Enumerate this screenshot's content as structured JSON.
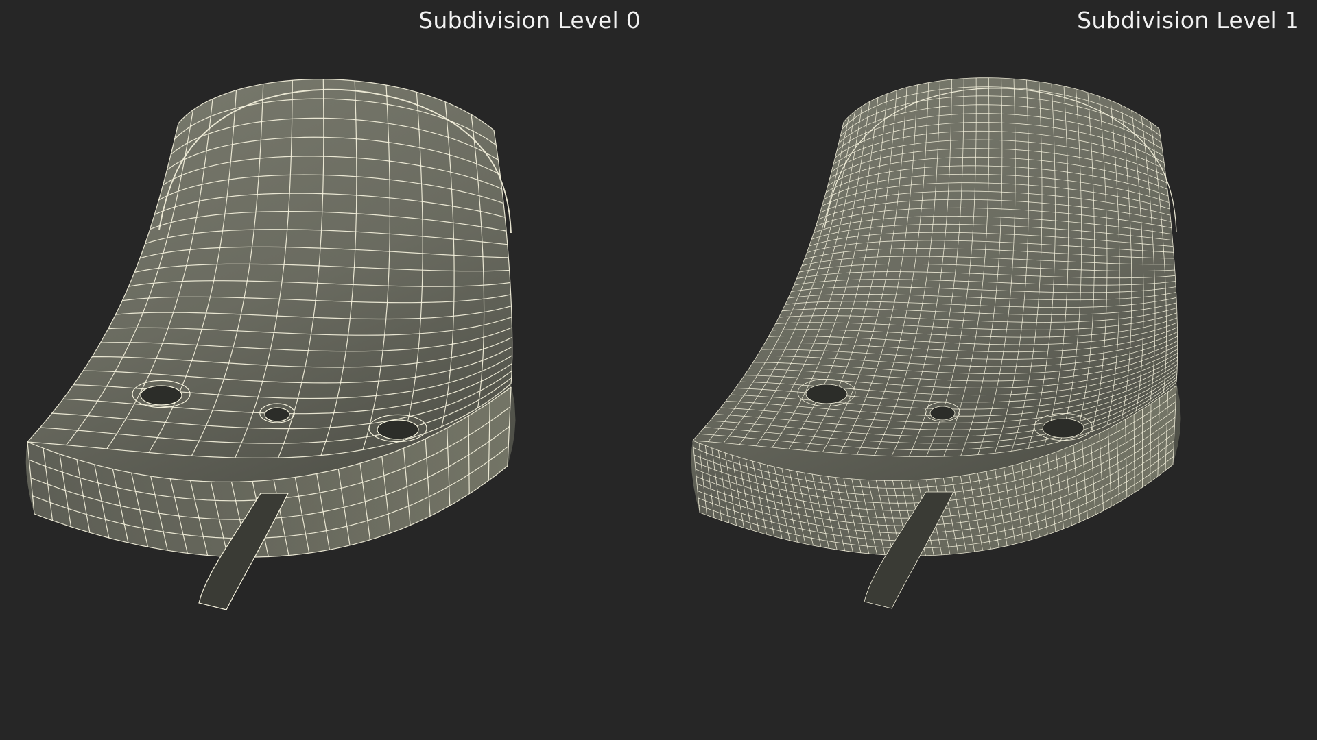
{
  "labels": {
    "left": "Subdivision Level 0",
    "right": "Subdivision Level 1"
  },
  "colors": {
    "background": "#262626",
    "surface_light": "#7a7b6e",
    "surface_dark": "#4f5048",
    "wire": "#f4f1dc",
    "text": "#f2f2f2"
  },
  "models": [
    {
      "name": "seat-subdivision-0",
      "u_divisions": 12,
      "v_divisions": 22
    },
    {
      "name": "seat-subdivision-1",
      "u_divisions": 30,
      "v_divisions": 48
    }
  ]
}
